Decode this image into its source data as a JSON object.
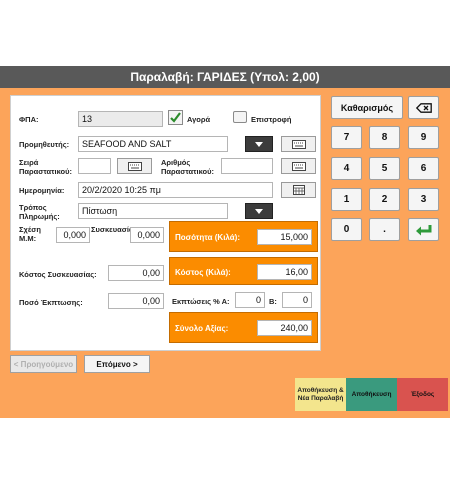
{
  "window": {
    "title": "Παραλαβή: ΓΑΡΙΔΕΣ (Υπολ:  2,00)"
  },
  "form": {
    "vat_label": "ΦΠΑ:",
    "vat_value": "13",
    "purchase_label": "Αγορά",
    "purchase_checked": true,
    "return_label": "Επιστροφή",
    "return_checked": false,
    "supplier_label": "Προμηθευτής:",
    "supplier_value": "SEAFOOD AND SALT",
    "series_label": "Σειρά Παραστατικού:",
    "series_value": "",
    "docnum_label": "Αριθμός Παραστατικού:",
    "docnum_value": "",
    "date_label": "Ημερομηνία:",
    "date_value": "20/2/2020 10:25 πμ",
    "payment_label": "Τρόπος Πληρωμής:",
    "payment_value": "Πίστωση",
    "relation_label": "Σχέση Μ.Μ:",
    "relation_value": "0,000",
    "packaging_label": "Συσκευασίας:",
    "packaging_value": "0,000",
    "packaging_cost_label": "Κόστος Συσκευασίας:",
    "packaging_cost_value": "0,00",
    "discount_amount_label": "Ποσό Έκπτωσης:",
    "discount_amount_value": "0,00",
    "discounts_pct_label": "Εκπτώσεις % Α:",
    "discount_a_value": "0",
    "discount_b_label": "Β:",
    "discount_b_value": "0",
    "quantity_label": "Ποσότητα (Κιλά):",
    "quantity_value": "15,000",
    "cost_label": "Κόστος (Κιλά):",
    "cost_value": "16,00",
    "total_label": "Σύνολο Αξίας:",
    "total_value": "240,00"
  },
  "keypad": {
    "clear_label": "Καθαρισμός",
    "keys": [
      "7",
      "8",
      "9",
      "4",
      "5",
      "6",
      "1",
      "2",
      "3",
      "0",
      "."
    ]
  },
  "nav": {
    "previous_label": "< Προηγούμενο",
    "next_label": "Επόμενο >"
  },
  "actions": {
    "save_new_label": "Αποθήκευση & Νέα Παραλαβή",
    "save_label": "Αποθήκευση",
    "exit_label": "Έξοδος"
  },
  "colors": {
    "background": "#fca45a",
    "titlebar": "#595959",
    "highlight_box": "#fb8c00",
    "save_new": "#f3e58d",
    "save": "#3a9a7e",
    "exit": "#d9534f",
    "enter_key": "#2e9a3a"
  }
}
